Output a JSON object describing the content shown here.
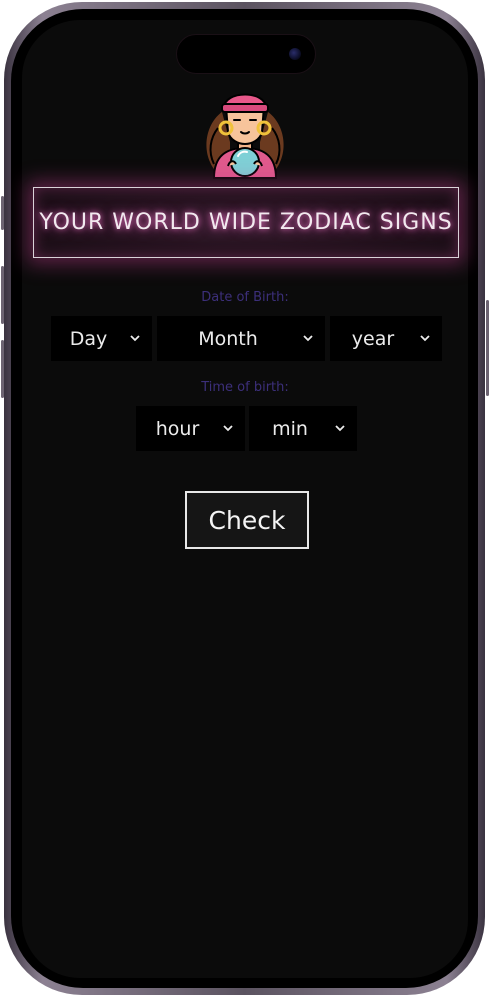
{
  "header": {
    "title": "YOUR WORLD WIDE ZODIAC SIGNS"
  },
  "birth_date": {
    "label": "Date of Birth:",
    "day_select": {
      "value": "Day"
    },
    "month_select": {
      "value": "Month"
    },
    "year_select": {
      "value": "year"
    }
  },
  "birth_time": {
    "label": "Time of birth:",
    "hour_select": {
      "value": "hour"
    },
    "minute_select": {
      "value": "min"
    }
  },
  "actions": {
    "check_label": "Check"
  },
  "icons": {
    "avatar": "fortune-teller-icon",
    "dropdown": "chevron-down-icon",
    "camera": "front-camera-icon"
  },
  "colors": {
    "screen_background": "#0b0b0b",
    "title_glow": "#c83c8c",
    "label_text": "#3c2f7a",
    "select_background": "#000000",
    "button_border": "#e8e8e8"
  }
}
